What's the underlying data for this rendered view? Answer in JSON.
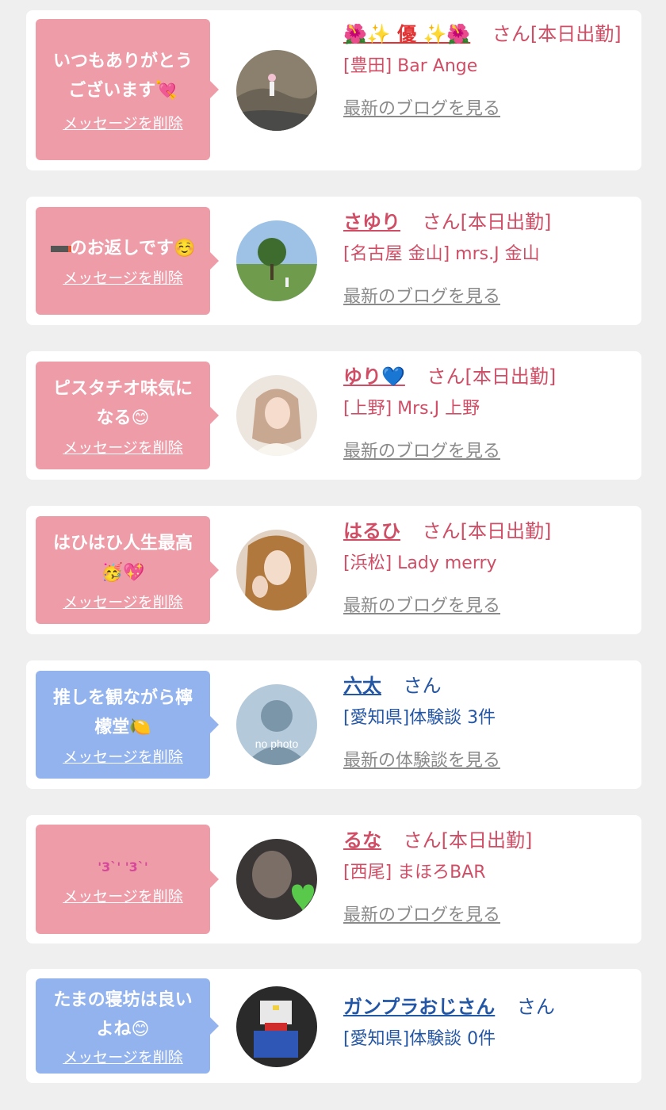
{
  "delete_label": "メッセージを削除",
  "san": "さん",
  "items": [
    {
      "message": "いつもありがとうございます💘",
      "name": "🌺✨ 優 ✨🌺",
      "status": "[本日出勤]",
      "location": "[豊田] Bar Ange",
      "link": "最新のブログを見る",
      "color": "pink"
    },
    {
      "message": "のお返しです☺️",
      "name": "さゆり",
      "status": "[本日出勤]",
      "location": "[名古屋 金山] mrs.J 金山",
      "link": "最新のブログを見る",
      "color": "pink"
    },
    {
      "message": "ピスタチオ味気になる😊",
      "name": "ゆり💙",
      "status": "[本日出勤]",
      "location": "[上野] Mrs.J 上野",
      "link": "最新のブログを見る",
      "color": "pink"
    },
    {
      "message": "はひはひ人生最高🥳💖",
      "name": "はるひ",
      "status": "[本日出勤]",
      "location": "[浜松] Lady merry",
      "link": "最新のブログを見る",
      "color": "pink"
    },
    {
      "message": "推しを観ながら檸檬堂🍋",
      "name": "六太",
      "status": "",
      "location": "[愛知県]体験談 3件",
      "link": "最新の体験談を見る",
      "color": "blue",
      "avatar_text": "no photo"
    },
    {
      "message": "'3`' '3`'",
      "name": "るな",
      "status": "[本日出勤]",
      "location": "[西尾] まほろBAR",
      "link": "最新のブログを見る",
      "color": "pink"
    },
    {
      "message": "たまの寝坊は良いよね😊",
      "name": "ガンプラおじさん",
      "status": "",
      "location": "[愛知県]体験談 0件",
      "link": "",
      "color": "blue"
    }
  ],
  "colors": {
    "pink_bubble": "#ee9ca8",
    "blue_bubble": "#93b3ee",
    "pink_text": "#cf4e66",
    "blue_text": "#2456a6",
    "bg": "#efefef"
  }
}
